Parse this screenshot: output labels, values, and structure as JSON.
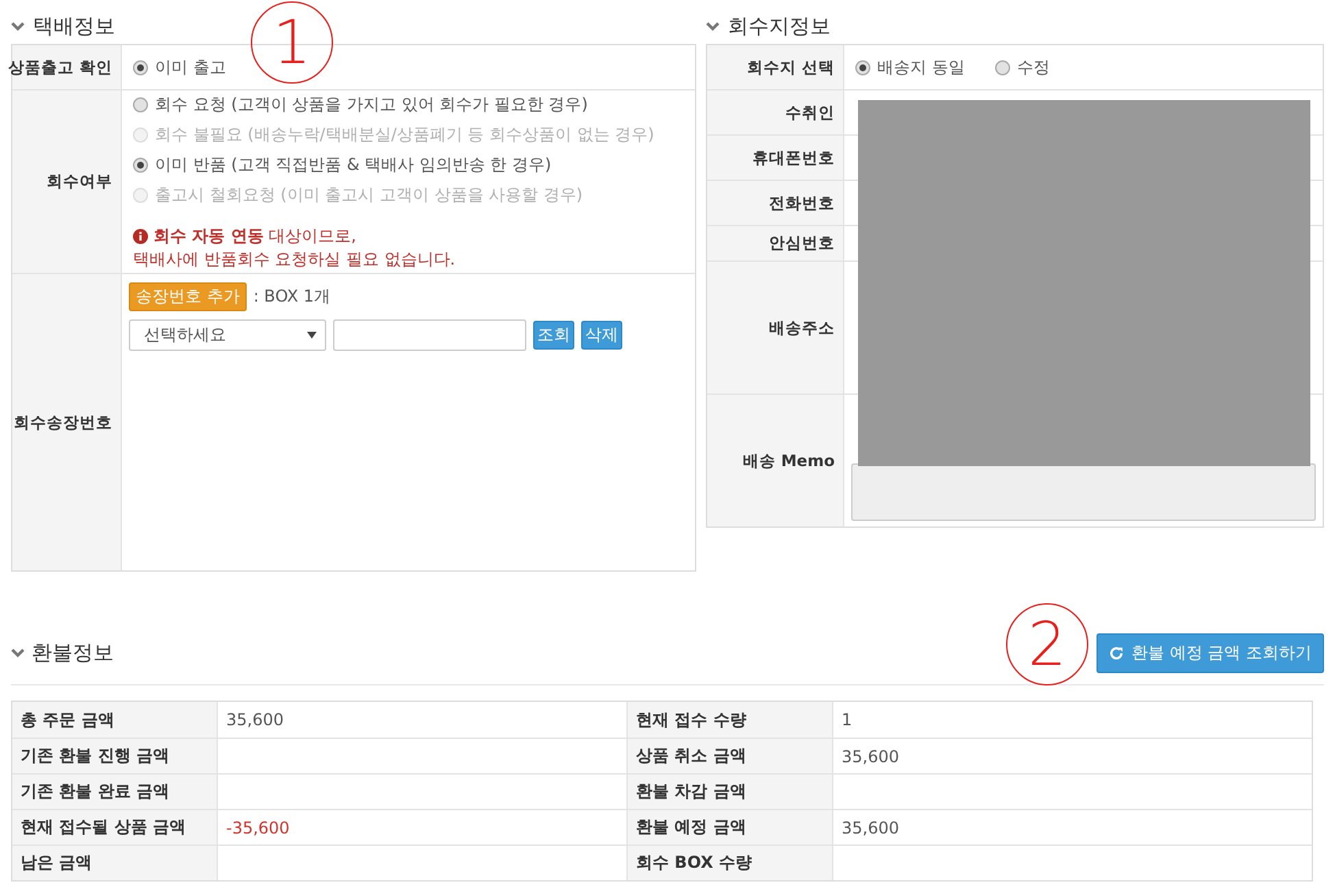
{
  "delivery": {
    "title": "택배정보",
    "annotation": "1",
    "shipment": {
      "label": "상품출고 확인",
      "options": [
        {
          "label": "이미 출고",
          "selected": true,
          "disabled": false
        }
      ]
    },
    "pickup": {
      "label": "회수여부",
      "options": [
        {
          "label": "회수 요청 (고객이 상품을 가지고 있어 회수가 필요한 경우)",
          "selected": false,
          "disabled": false
        },
        {
          "label": "회수 불필요 (배송누락/택배분실/상품폐기 등 회수상품이 없는 경우)",
          "selected": false,
          "disabled": true
        },
        {
          "label": "이미 반품 (고객 직접반품 & 택배사 임의반송 한 경우)",
          "selected": true,
          "disabled": false
        },
        {
          "label": "출고시 철회요청 (이미 출고시 고객이 상품을 사용할 경우)",
          "selected": false,
          "disabled": true
        }
      ],
      "notice": "**회수 자동 연동** 대상이므로,",
      "notice_2": "택배사에 반품회수 요청하실 필요 없습니다."
    },
    "invoice": {
      "label": "회수송장번호",
      "add_button": "송장번호 추가",
      "box_count": ": BOX 1개",
      "select_placeholder": "선택하세요",
      "buttons": [
        "조회",
        "삭제"
      ]
    }
  },
  "return_address": {
    "title": "회수지정보",
    "rows": [
      {
        "kind": "radio",
        "label": "회수지 선택",
        "options": [
          {
            "label": "배송지 동일",
            "selected": true
          },
          {
            "label": "수정",
            "selected": false
          }
        ]
      },
      {
        "kind": "input",
        "label": "수취인"
      },
      {
        "kind": "input",
        "label": "휴대폰번호"
      },
      {
        "kind": "input",
        "label": "전화번호"
      },
      {
        "kind": "blank",
        "label": "안심번호"
      },
      {
        "kind": "address",
        "label": "배송주소"
      },
      {
        "kind": "memo",
        "label": "배송 Memo"
      }
    ]
  },
  "refund": {
    "title": "환불정보",
    "annotation": "2",
    "button": "환불 예정 금액 조회하기",
    "rows": [
      {
        "label": "총 주문 금액",
        "value": "35,600",
        "negative": false,
        "label_2": "현재 접수 수량",
        "value_2": "1"
      },
      {
        "label": "기존 환불 진행 금액",
        "value": "",
        "label_2": "상품 취소 금액",
        "value_2": "35,600"
      },
      {
        "label": "기존 환불 완료 금액",
        "value": "",
        "label_2": "환불 차감 금액",
        "value_2": ""
      },
      {
        "label": "현재 접수될 상품 금액",
        "value": "-35,600",
        "negative": true,
        "label_2": "환불 예정 금액",
        "value_2": "35,600"
      },
      {
        "label": "남은 금액",
        "value": "",
        "label_2": "회수 BOX 수량",
        "value_2": ""
      }
    ]
  }
}
